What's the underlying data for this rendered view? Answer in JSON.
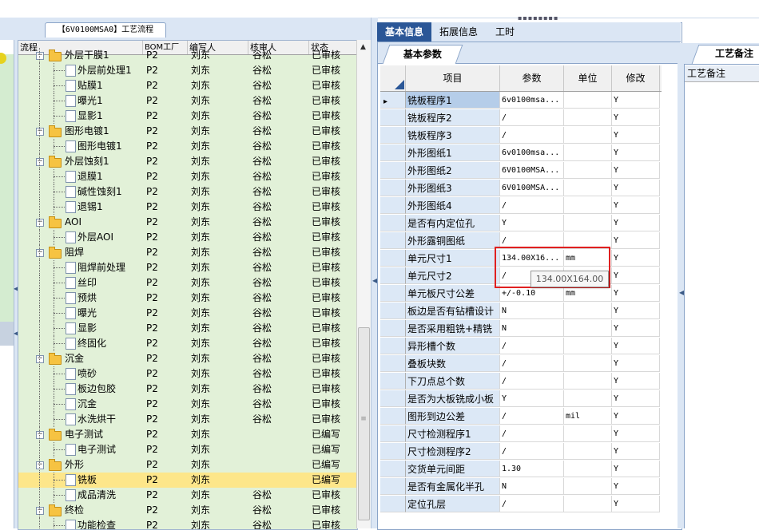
{
  "flow_tab": "【6V0100MSA0】工艺流程",
  "left_grid": {
    "columns": [
      "流程",
      "BOM工厂",
      "编写人",
      "核审人",
      "状态"
    ],
    "rows": [
      {
        "name": "外层干膜1",
        "level": 1,
        "type": "folder",
        "bom": "P2",
        "writer": "刘东",
        "reviewer": "谷松",
        "status": "已审核",
        "partial": true
      },
      {
        "name": "外层前处理1",
        "level": 2,
        "type": "doc",
        "bom": "P2",
        "writer": "刘东",
        "reviewer": "谷松",
        "status": "已审核"
      },
      {
        "name": "贴膜1",
        "level": 2,
        "type": "doc",
        "bom": "P2",
        "writer": "刘东",
        "reviewer": "谷松",
        "status": "已审核"
      },
      {
        "name": "曝光1",
        "level": 2,
        "type": "doc",
        "bom": "P2",
        "writer": "刘东",
        "reviewer": "谷松",
        "status": "已审核"
      },
      {
        "name": "显影1",
        "level": 2,
        "type": "doc",
        "bom": "P2",
        "writer": "刘东",
        "reviewer": "谷松",
        "status": "已审核"
      },
      {
        "name": "图形电镀1",
        "level": 1,
        "type": "folder",
        "bom": "P2",
        "writer": "刘东",
        "reviewer": "谷松",
        "status": "已审核"
      },
      {
        "name": "图形电镀1",
        "level": 2,
        "type": "doc",
        "bom": "P2",
        "writer": "刘东",
        "reviewer": "谷松",
        "status": "已审核"
      },
      {
        "name": "外层蚀刻1",
        "level": 1,
        "type": "folder",
        "bom": "P2",
        "writer": "刘东",
        "reviewer": "谷松",
        "status": "已审核"
      },
      {
        "name": "退膜1",
        "level": 2,
        "type": "doc",
        "bom": "P2",
        "writer": "刘东",
        "reviewer": "谷松",
        "status": "已审核"
      },
      {
        "name": "碱性蚀刻1",
        "level": 2,
        "type": "doc",
        "bom": "P2",
        "writer": "刘东",
        "reviewer": "谷松",
        "status": "已审核"
      },
      {
        "name": "退锡1",
        "level": 2,
        "type": "doc",
        "bom": "P2",
        "writer": "刘东",
        "reviewer": "谷松",
        "status": "已审核"
      },
      {
        "name": "AOI",
        "level": 1,
        "type": "folder",
        "bom": "P2",
        "writer": "刘东",
        "reviewer": "谷松",
        "status": "已审核"
      },
      {
        "name": "外层AOI",
        "level": 2,
        "type": "doc",
        "bom": "P2",
        "writer": "刘东",
        "reviewer": "谷松",
        "status": "已审核"
      },
      {
        "name": "阻焊",
        "level": 1,
        "type": "folder",
        "bom": "P2",
        "writer": "刘东",
        "reviewer": "谷松",
        "status": "已审核"
      },
      {
        "name": "阻焊前处理",
        "level": 2,
        "type": "doc",
        "bom": "P2",
        "writer": "刘东",
        "reviewer": "谷松",
        "status": "已审核"
      },
      {
        "name": "丝印",
        "level": 2,
        "type": "doc",
        "bom": "P2",
        "writer": "刘东",
        "reviewer": "谷松",
        "status": "已审核"
      },
      {
        "name": "预烘",
        "level": 2,
        "type": "doc",
        "bom": "P2",
        "writer": "刘东",
        "reviewer": "谷松",
        "status": "已审核"
      },
      {
        "name": "曝光",
        "level": 2,
        "type": "doc",
        "bom": "P2",
        "writer": "刘东",
        "reviewer": "谷松",
        "status": "已审核"
      },
      {
        "name": "显影",
        "level": 2,
        "type": "doc",
        "bom": "P2",
        "writer": "刘东",
        "reviewer": "谷松",
        "status": "已审核"
      },
      {
        "name": "终固化",
        "level": 2,
        "type": "doc",
        "bom": "P2",
        "writer": "刘东",
        "reviewer": "谷松",
        "status": "已审核"
      },
      {
        "name": "沉金",
        "level": 1,
        "type": "folder",
        "bom": "P2",
        "writer": "刘东",
        "reviewer": "谷松",
        "status": "已审核"
      },
      {
        "name": "喷砂",
        "level": 2,
        "type": "doc",
        "bom": "P2",
        "writer": "刘东",
        "reviewer": "谷松",
        "status": "已审核"
      },
      {
        "name": "板边包胶",
        "level": 2,
        "type": "doc",
        "bom": "P2",
        "writer": "刘东",
        "reviewer": "谷松",
        "status": "已审核"
      },
      {
        "name": "沉金",
        "level": 2,
        "type": "doc",
        "bom": "P2",
        "writer": "刘东",
        "reviewer": "谷松",
        "status": "已审核"
      },
      {
        "name": "水洗烘干",
        "level": 2,
        "type": "doc",
        "bom": "P2",
        "writer": "刘东",
        "reviewer": "谷松",
        "status": "已审核"
      },
      {
        "name": "电子测试",
        "level": 1,
        "type": "folder",
        "bom": "P2",
        "writer": "刘东",
        "reviewer": "",
        "status": "已编写"
      },
      {
        "name": "电子测试",
        "level": 2,
        "type": "doc",
        "bom": "P2",
        "writer": "刘东",
        "reviewer": "",
        "status": "已编写"
      },
      {
        "name": "外形",
        "level": 1,
        "type": "folder",
        "bom": "P2",
        "writer": "刘东",
        "reviewer": "",
        "status": "已编写"
      },
      {
        "name": "铣板",
        "level": 2,
        "type": "doc",
        "bom": "P2",
        "writer": "刘东",
        "reviewer": "",
        "status": "已编写",
        "selected": true
      },
      {
        "name": "成品清洗",
        "level": 2,
        "type": "doc",
        "bom": "P2",
        "writer": "刘东",
        "reviewer": "谷松",
        "status": "已审核"
      },
      {
        "name": "终检",
        "level": 1,
        "type": "folder",
        "bom": "P2",
        "writer": "刘东",
        "reviewer": "谷松",
        "status": "已审核"
      },
      {
        "name": "功能检查",
        "level": 2,
        "type": "doc",
        "bom": "P2",
        "writer": "刘东",
        "reviewer": "谷松",
        "status": "已审核"
      }
    ]
  },
  "right_tabs": [
    "基本信息",
    "拓展信息",
    "工时"
  ],
  "sub_tab": "基本参数",
  "param_grid": {
    "columns": [
      "项目",
      "参数",
      "单位",
      "修改"
    ],
    "rows": [
      {
        "item": "铣板程序1",
        "param": "6v0100msa...",
        "unit": "",
        "mod": "Y",
        "current": true
      },
      {
        "item": "铣板程序2",
        "param": "/",
        "unit": "",
        "mod": "Y"
      },
      {
        "item": "铣板程序3",
        "param": "/",
        "unit": "",
        "mod": "Y"
      },
      {
        "item": "外形图纸1",
        "param": "6v0100msa...",
        "unit": "",
        "mod": "Y"
      },
      {
        "item": "外形图纸2",
        "param": "6V0100MSA...",
        "unit": "",
        "mod": "Y"
      },
      {
        "item": "外形图纸3",
        "param": "6V0100MSA...",
        "unit": "",
        "mod": "Y"
      },
      {
        "item": "外形图纸4",
        "param": "/",
        "unit": "",
        "mod": "Y"
      },
      {
        "item": "是否有内定位孔",
        "param": "Y",
        "unit": "",
        "mod": "Y"
      },
      {
        "item": "外形露铜图纸",
        "param": "/",
        "unit": "",
        "mod": "Y"
      },
      {
        "item": "单元尺寸1",
        "param": "134.00X16...",
        "unit": "mm",
        "mod": "Y"
      },
      {
        "item": "单元尺寸2",
        "param": "/",
        "unit": "",
        "mod": "Y"
      },
      {
        "item": "单元板尺寸公差",
        "param": "+/-0.10",
        "unit": "mm",
        "mod": "Y"
      },
      {
        "item": "板边是否有钻槽设计",
        "param": "N",
        "unit": "",
        "mod": "Y"
      },
      {
        "item": "是否采用粗铣+精铣",
        "param": "N",
        "unit": "",
        "mod": "Y"
      },
      {
        "item": "异形槽个数",
        "param": "/",
        "unit": "",
        "mod": "Y"
      },
      {
        "item": "叠板块数",
        "param": "/",
        "unit": "",
        "mod": "Y"
      },
      {
        "item": "下刀点总个数",
        "param": "/",
        "unit": "",
        "mod": "Y"
      },
      {
        "item": "是否为大板铣成小板",
        "param": "Y",
        "unit": "",
        "mod": "Y"
      },
      {
        "item": "图形到边公差",
        "param": "/",
        "unit": "mil",
        "mod": "Y"
      },
      {
        "item": "尺寸检测程序1",
        "param": "/",
        "unit": "",
        "mod": "Y"
      },
      {
        "item": "尺寸检测程序2",
        "param": "/",
        "unit": "",
        "mod": "Y"
      },
      {
        "item": "交货单元间距",
        "param": "1.30",
        "unit": "",
        "mod": "Y"
      },
      {
        "item": "是否有金属化半孔",
        "param": "N",
        "unit": "",
        "mod": "Y"
      },
      {
        "item": "定位孔层",
        "param": "/",
        "unit": "",
        "mod": "Y"
      }
    ]
  },
  "tooltip": "134.00X164.00",
  "right_panel": {
    "tab": "工艺备注",
    "column": "工艺备注"
  },
  "colors": {
    "accent_tab": "#2b5797",
    "selected_row": "#fde68a",
    "tree_bg": "#e2f1d8",
    "highlight_box": "#e02020"
  }
}
